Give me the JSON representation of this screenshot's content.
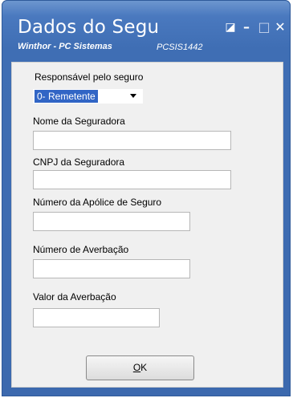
{
  "window": {
    "title": "Dados do Segu",
    "subtitle": "Winthor - PC Sistemas",
    "program_code": "PCSIS1442",
    "controls": {
      "restore_icon": "◪",
      "minimize_icon": "–",
      "maximize_icon": "□",
      "close_icon": "✕"
    }
  },
  "form": {
    "responsavel": {
      "label": "Responsável pelo seguro",
      "selected": "0- Remetente"
    },
    "nome_seguradora": {
      "label": "Nome da Seguradora",
      "value": ""
    },
    "cnpj_seguradora": {
      "label": "CNPJ da Seguradora",
      "value": ""
    },
    "numero_apolice": {
      "label": "Número da Apólice de Seguro",
      "value": ""
    },
    "numero_averbacao": {
      "label": "Número de Averbação",
      "value": ""
    },
    "valor_averbacao": {
      "label": "Valor da Averbação",
      "value": ""
    }
  },
  "ok_button": {
    "hotkey": "O",
    "rest": "K"
  },
  "colors": {
    "titlebar": "#4a79bf",
    "selection": "#3165c5",
    "client_bg": "#f0f0f0"
  }
}
